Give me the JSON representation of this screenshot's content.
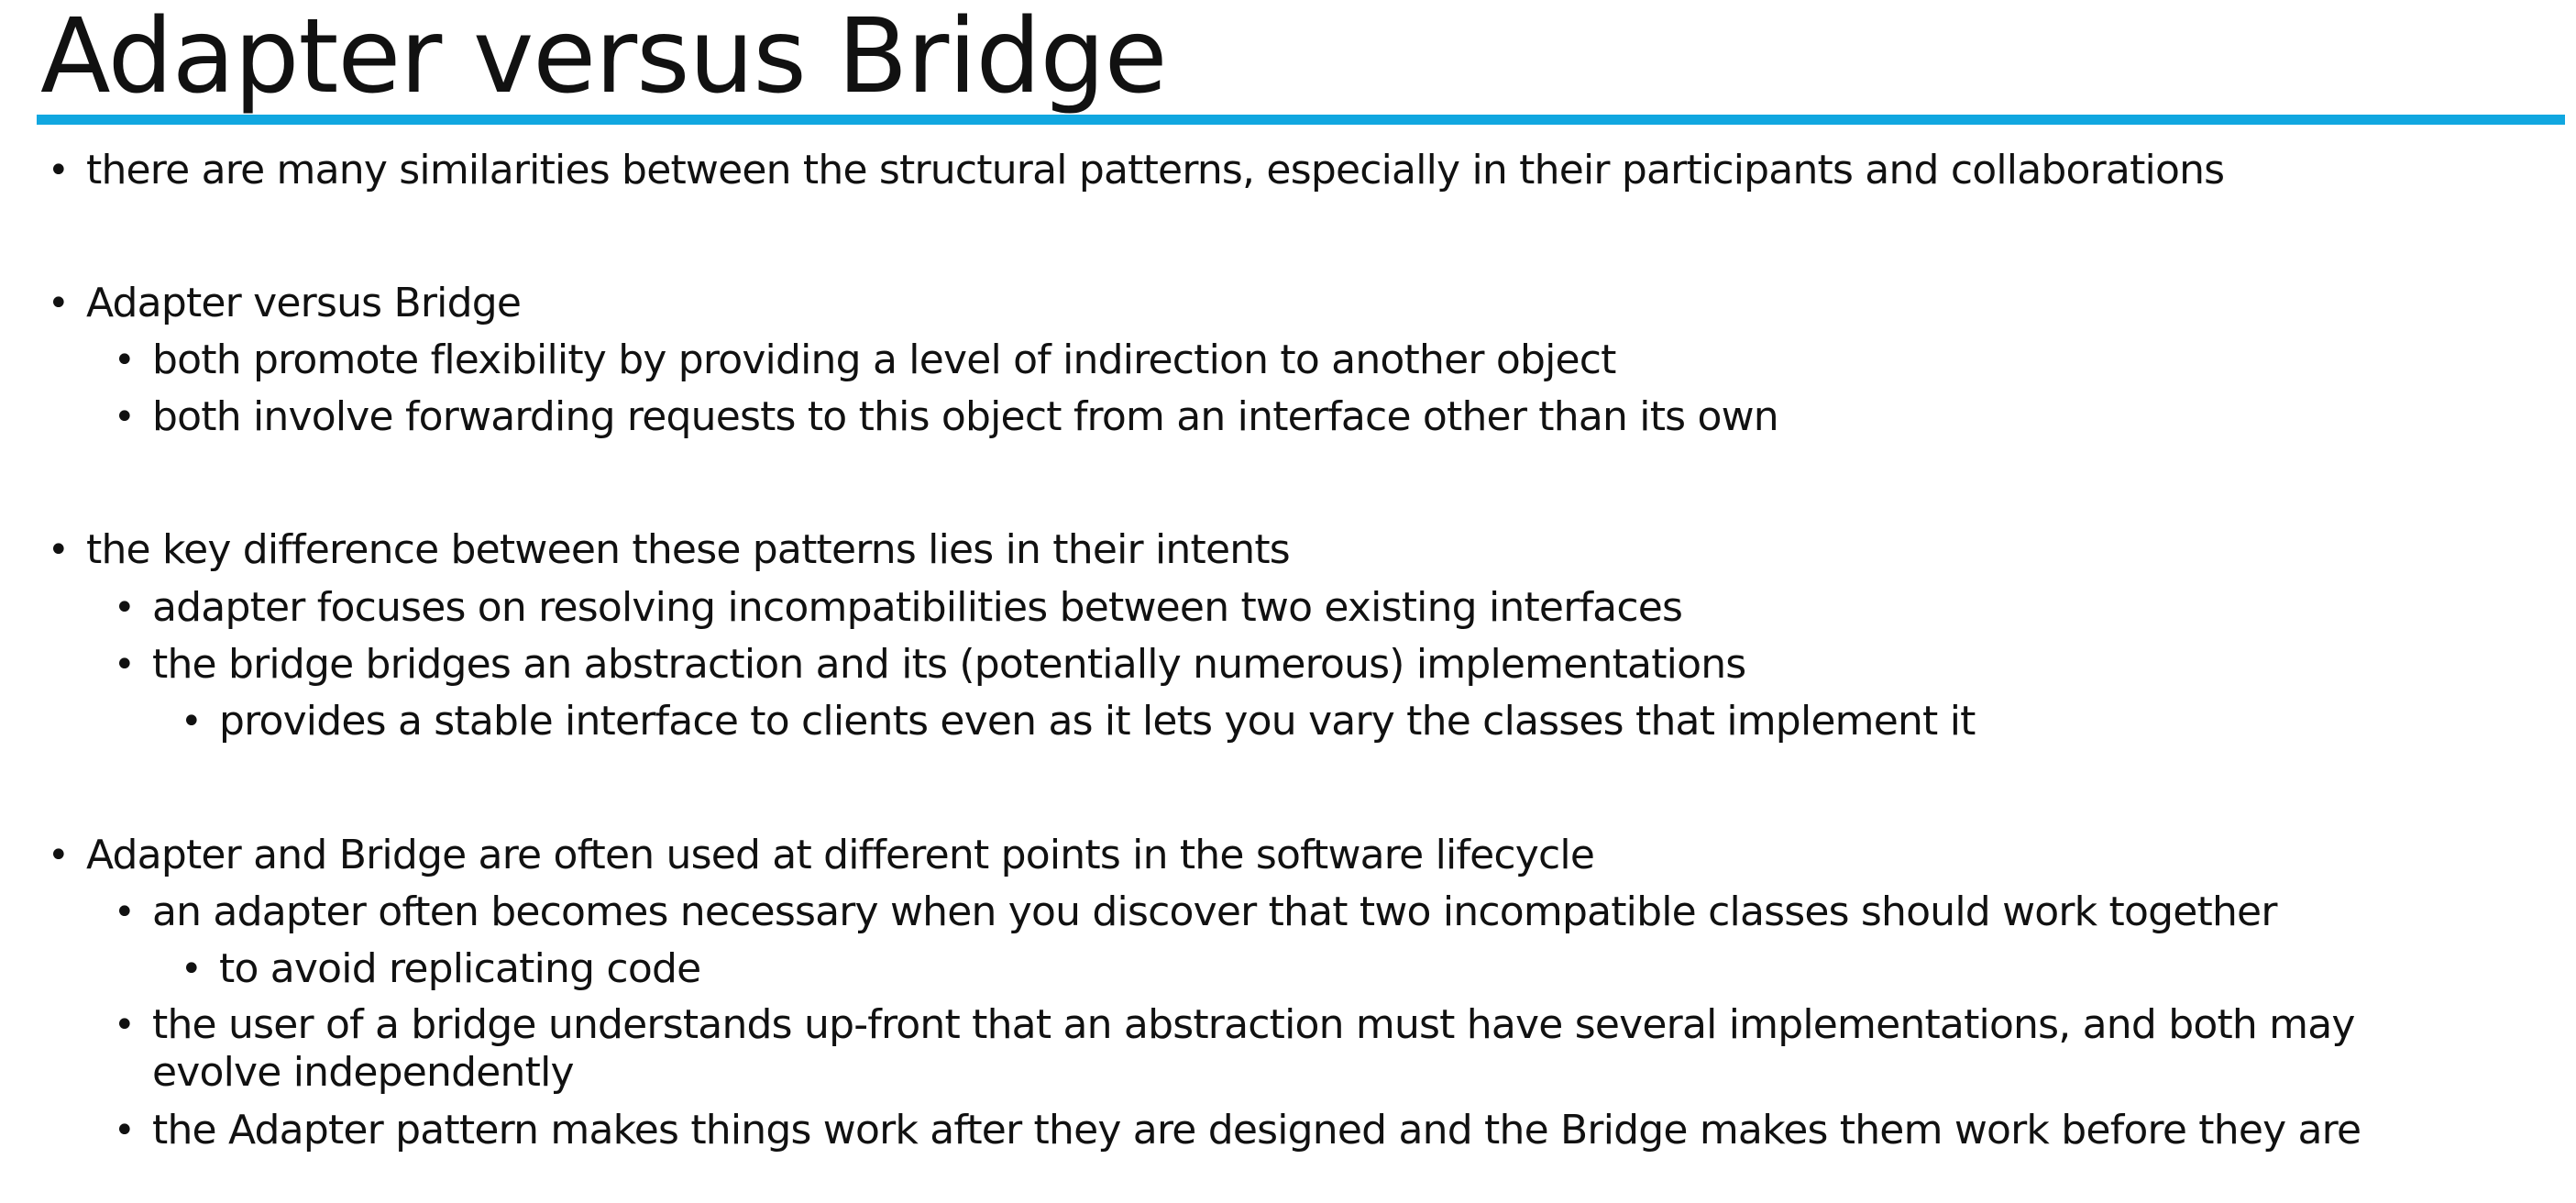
{
  "title": "Adapter versus Bridge",
  "accent_color": "#11a7e0",
  "bullet_char": "•",
  "bullets": [
    {
      "level": 1,
      "text": "there are many similarities between the structural patterns, especially in their participants and collaborations"
    },
    {
      "level": 1,
      "text": "Adapter versus Bridge"
    },
    {
      "level": 2,
      "text": "both promote flexibility by providing a level of indirection to another object"
    },
    {
      "level": 2,
      "text": "both involve forwarding requests to this object from an interface other than its own"
    },
    {
      "level": 1,
      "text": "the key difference between these patterns lies in their intents"
    },
    {
      "level": 2,
      "text": "adapter focuses on resolving incompatibilities between two existing interfaces"
    },
    {
      "level": 2,
      "text": "the bridge bridges an abstraction and its (potentially numerous) implementations"
    },
    {
      "level": 3,
      "text": "provides a stable interface to clients even as it lets you vary the classes that implement it"
    },
    {
      "level": 1,
      "text": "Adapter and Bridge are often used at different points in the software lifecycle"
    },
    {
      "level": 2,
      "text": "an adapter often becomes necessary when you discover that two incompatible classes should work together"
    },
    {
      "level": 3,
      "text": "to avoid replicating code"
    },
    {
      "level": 2,
      "text": "the user of a bridge understands up-front that an abstraction must have several implementations, and both may"
    },
    {
      "level": 2,
      "text": "evolve independently",
      "continuation": true
    },
    {
      "level": 2,
      "text": "the Adapter pattern makes things work after they are designed and the Bridge makes them work before they are"
    }
  ]
}
